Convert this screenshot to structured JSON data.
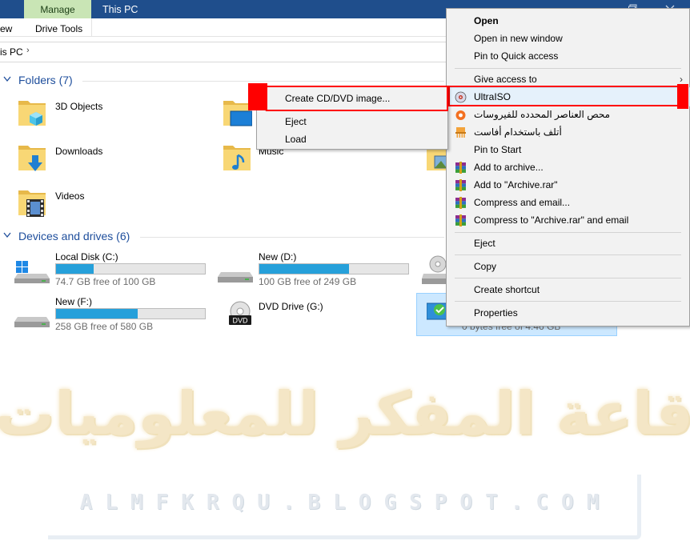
{
  "ribbon": {
    "manage": "Manage",
    "this_pc": "This PC",
    "view": "ew",
    "drive_tools": "Drive Tools"
  },
  "address": {
    "text": "is PC",
    "chevron": "›"
  },
  "folders": {
    "header": "Folders (7)",
    "items": [
      {
        "label": "3D Objects",
        "icon": "3d-objects-folder-icon"
      },
      {
        "label": "Music",
        "icon": "music-folder-icon"
      },
      {
        "label": "Downloads",
        "icon": "downloads-folder-icon"
      },
      {
        "label": "Videos",
        "icon": "videos-folder-icon"
      }
    ]
  },
  "drives": {
    "header": "Devices and drives (6)",
    "items": [
      {
        "name": "Local Disk (C:)",
        "free": "74.7 GB free of 100 GB",
        "used_fraction": 0.25
      },
      {
        "name": "New (D:)",
        "free": "100 GB free of 249 GB",
        "used_fraction": 0.6
      },
      {
        "name": "New (F:)",
        "free": "258 GB free of 580 GB",
        "used_fraction": 0.55
      },
      {
        "name": "DVD Drive (G:)",
        "dvd_label": "DVD"
      },
      {
        "free": "0 bytes free of 4.46 GB"
      }
    ]
  },
  "context_menu": {
    "open": "Open",
    "open_new_window": "Open in new window",
    "pin_quick_access": "Pin to Quick access",
    "give_access": "Give access to",
    "ultraiso": "UltraISO",
    "avast_scan": "محص العناصر المحدده للفيروسات",
    "avast_shred": "أتلف باستخدام أفاست",
    "pin_start": "Pin to Start",
    "add_archive": "Add to archive...",
    "add_archive_rar": "Add to \"Archive.rar\"",
    "compress_email": "Compress and email...",
    "compress_rar_email": "Compress to \"Archive.rar\" and email",
    "eject": "Eject",
    "copy": "Copy",
    "create_shortcut": "Create shortcut",
    "properties": "Properties",
    "arrow": "›"
  },
  "submenu": {
    "create_image": "Create CD/DVD image...",
    "eject": "Eject",
    "load": "Load"
  },
  "watermark": {
    "arabic": "قاعة المفكر للمعلوميات",
    "latin": "ALMFKRQU.BLOGSPOT.COM"
  },
  "colors": {
    "accent": "#26a0da",
    "group_header": "#1e4e9c",
    "highlight_red": "#ff0000",
    "manage_tab": "#c9e5b5"
  }
}
